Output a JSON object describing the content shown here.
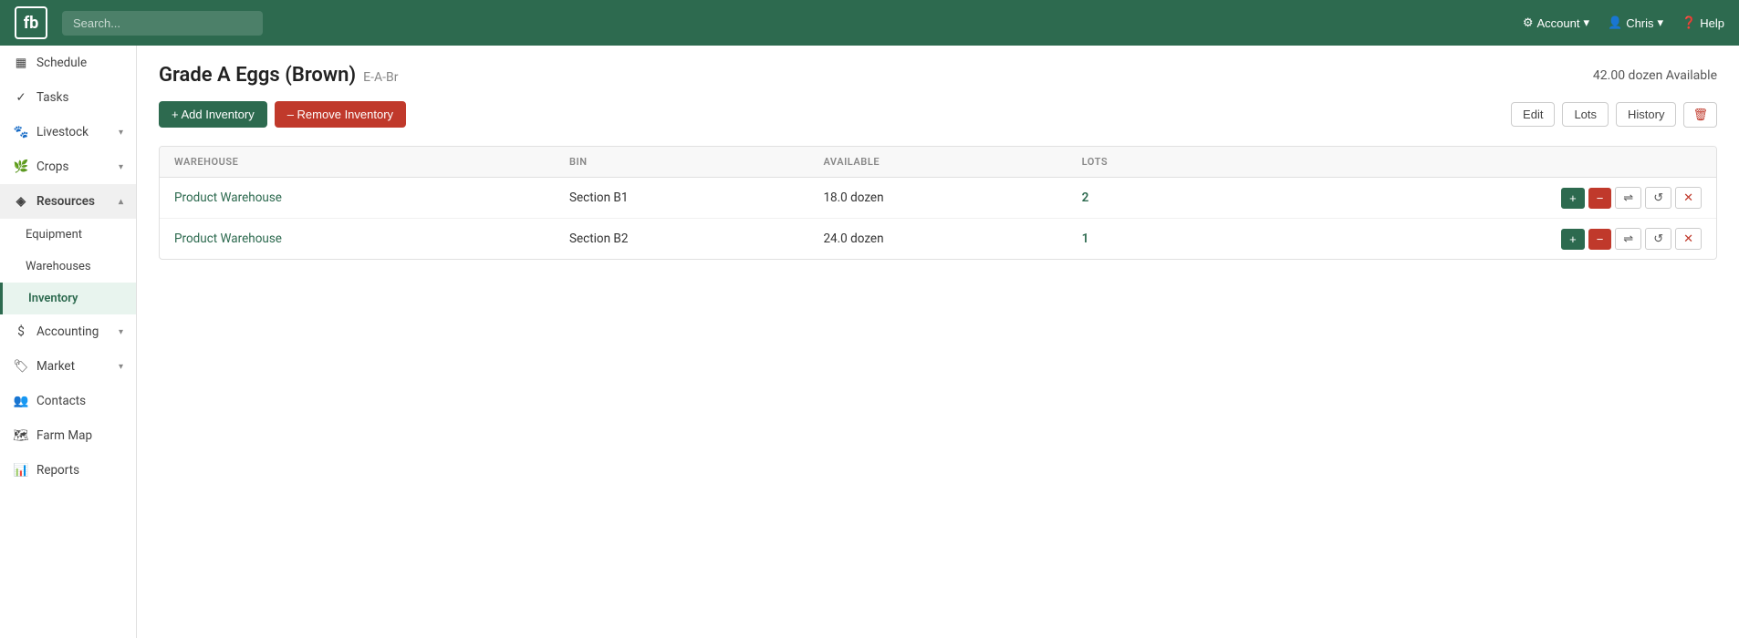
{
  "app": {
    "logo": "fb",
    "search_placeholder": "Search..."
  },
  "topnav": {
    "account_label": "Account",
    "user_label": "Chris",
    "help_label": "Help"
  },
  "sidebar": {
    "items": [
      {
        "id": "schedule",
        "label": "Schedule",
        "icon": "calendar",
        "has_sub": false
      },
      {
        "id": "tasks",
        "label": "Tasks",
        "icon": "check-circle",
        "has_sub": false
      },
      {
        "id": "livestock",
        "label": "Livestock",
        "icon": "paw",
        "has_sub": true,
        "expanded": true
      },
      {
        "id": "crops",
        "label": "Crops",
        "icon": "leaf",
        "has_sub": true,
        "expanded": true
      },
      {
        "id": "resources",
        "label": "Resources",
        "icon": "cube",
        "has_sub": true,
        "expanded": true,
        "active": true
      },
      {
        "id": "equipment",
        "label": "Equipment",
        "sub": true
      },
      {
        "id": "warehouses",
        "label": "Warehouses",
        "sub": true
      },
      {
        "id": "inventory",
        "label": "Inventory",
        "sub": true,
        "active": true
      },
      {
        "id": "accounting",
        "label": "Accounting",
        "icon": "dollar",
        "has_sub": true,
        "expanded": false
      },
      {
        "id": "market",
        "label": "Market",
        "icon": "tag",
        "has_sub": true,
        "expanded": false
      },
      {
        "id": "contacts",
        "label": "Contacts",
        "icon": "users",
        "has_sub": false
      },
      {
        "id": "farm-map",
        "label": "Farm Map",
        "icon": "map",
        "has_sub": false
      },
      {
        "id": "reports",
        "label": "Reports",
        "icon": "chart",
        "has_sub": false
      }
    ]
  },
  "page": {
    "title": "Grade A Eggs (Brown)",
    "code": "E-A-Br",
    "available": "42.00 dozen Available",
    "add_btn": "+ Add Inventory",
    "remove_btn": "– Remove Inventory",
    "edit_btn": "Edit",
    "lots_btn": "Lots",
    "history_btn": "History"
  },
  "table": {
    "columns": [
      {
        "id": "warehouse",
        "label": "WAREHOUSE"
      },
      {
        "id": "bin",
        "label": "BIN"
      },
      {
        "id": "available",
        "label": "AVAILABLE"
      },
      {
        "id": "lots",
        "label": "LOTS"
      },
      {
        "id": "actions",
        "label": ""
      }
    ],
    "rows": [
      {
        "warehouse": "Product Warehouse",
        "bin": "Section B1",
        "available": "18.0 dozen",
        "lots": "2"
      },
      {
        "warehouse": "Product Warehouse",
        "bin": "Section B2",
        "available": "24.0 dozen",
        "lots": "1"
      }
    ]
  }
}
